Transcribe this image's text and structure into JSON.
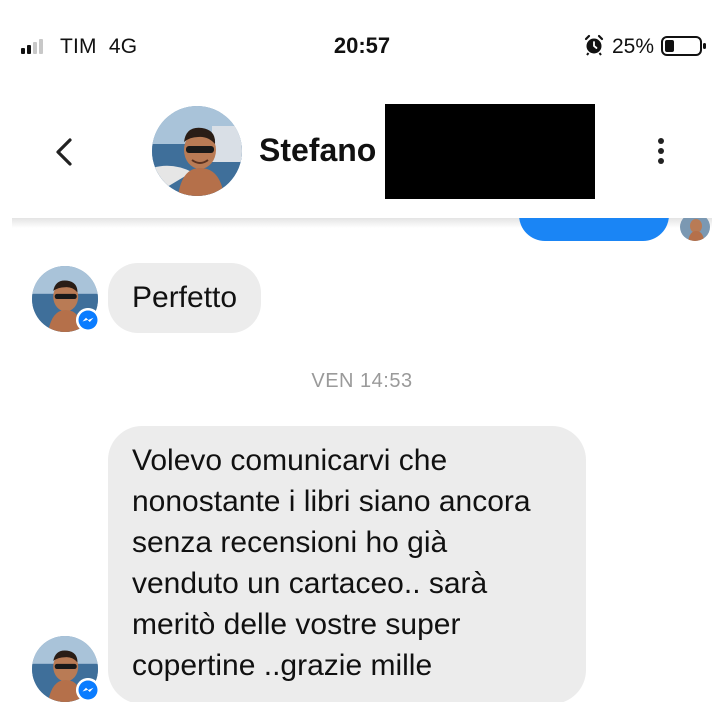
{
  "status_bar": {
    "carrier": "TIM",
    "network": "4G",
    "time": "20:57",
    "battery_percent": "25%",
    "signal_bars_active": 2,
    "signal_bars_total": 4
  },
  "header": {
    "contact_name": "Stefano",
    "back_icon": "chevron-left-icon",
    "more_icon": "vertical-ellipsis-icon"
  },
  "messages": [
    {
      "sender": "contact",
      "text": "Perfetto"
    },
    {
      "sender": "contact",
      "text": "Volevo comunicarvi che\nnonostante i libri siano ancora\nsenza recensioni ho già\nvenduto un cartaceo.. sarà\nmeritò delle vostre super\ncopertine ..grazie mille"
    }
  ],
  "timestamp": "VEN 14:53",
  "colors": {
    "outgoing_bubble": "#1a85f5",
    "incoming_bubble": "#ececec",
    "timestamp": "#9a9a9a",
    "messenger_badge": "#0a7cff"
  }
}
